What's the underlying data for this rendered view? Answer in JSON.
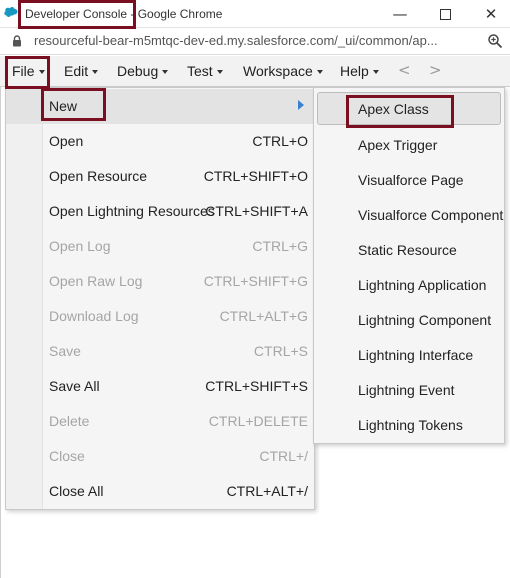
{
  "window": {
    "title": "Developer Console - Google Chrome",
    "controls": {
      "minimize": "—",
      "close": "✕"
    }
  },
  "address_bar": {
    "url": "resourceful-bear-m5mtqc-dev-ed.my.salesforce.com/_ui/common/ap..."
  },
  "menubar": {
    "items": [
      {
        "label": "File",
        "open": true
      },
      {
        "label": "Edit"
      },
      {
        "label": "Debug"
      },
      {
        "label": "Test"
      },
      {
        "label": "Workspace"
      },
      {
        "label": "Help"
      }
    ],
    "back_arrow": "<",
    "forward_arrow": ">"
  },
  "file_menu": {
    "items": [
      {
        "label": "New",
        "shortcut": "",
        "enabled": true,
        "has_submenu": true,
        "active": true
      },
      {
        "label": "Open",
        "shortcut": "CTRL+O",
        "enabled": true
      },
      {
        "label": "Open Resource",
        "shortcut": "CTRL+SHIFT+O",
        "enabled": true
      },
      {
        "label": "Open Lightning Resources",
        "shortcut": "CTRL+SHIFT+A",
        "enabled": true
      },
      {
        "label": "Open Log",
        "shortcut": "CTRL+G",
        "enabled": false
      },
      {
        "label": "Open Raw Log",
        "shortcut": "CTRL+SHIFT+G",
        "enabled": false
      },
      {
        "label": "Download Log",
        "shortcut": "CTRL+ALT+G",
        "enabled": false
      },
      {
        "label": "Save",
        "shortcut": "CTRL+S",
        "enabled": false
      },
      {
        "label": "Save All",
        "shortcut": "CTRL+SHIFT+S",
        "enabled": true
      },
      {
        "label": "Delete",
        "shortcut": "CTRL+DELETE",
        "enabled": false
      },
      {
        "label": "Close",
        "shortcut": "CTRL+/",
        "enabled": false
      },
      {
        "label": "Close All",
        "shortcut": "CTRL+ALT+/",
        "enabled": true
      }
    ]
  },
  "new_submenu": {
    "items": [
      {
        "label": "Apex Class",
        "active": true
      },
      {
        "label": "Apex Trigger"
      },
      {
        "label": "Visualforce Page"
      },
      {
        "label": "Visualforce Component"
      },
      {
        "label": "Static Resource"
      },
      {
        "label": "Lightning Application"
      },
      {
        "label": "Lightning Component"
      },
      {
        "label": "Lightning Interface"
      },
      {
        "label": "Lightning Event"
      },
      {
        "label": "Lightning Tokens"
      }
    ]
  },
  "colors": {
    "highlight_border": "#7b0f22",
    "submenu_arrow": "#3b7fd0",
    "salesforce_logo": "#1798c1",
    "disabled_text": "#a5a5a5"
  }
}
